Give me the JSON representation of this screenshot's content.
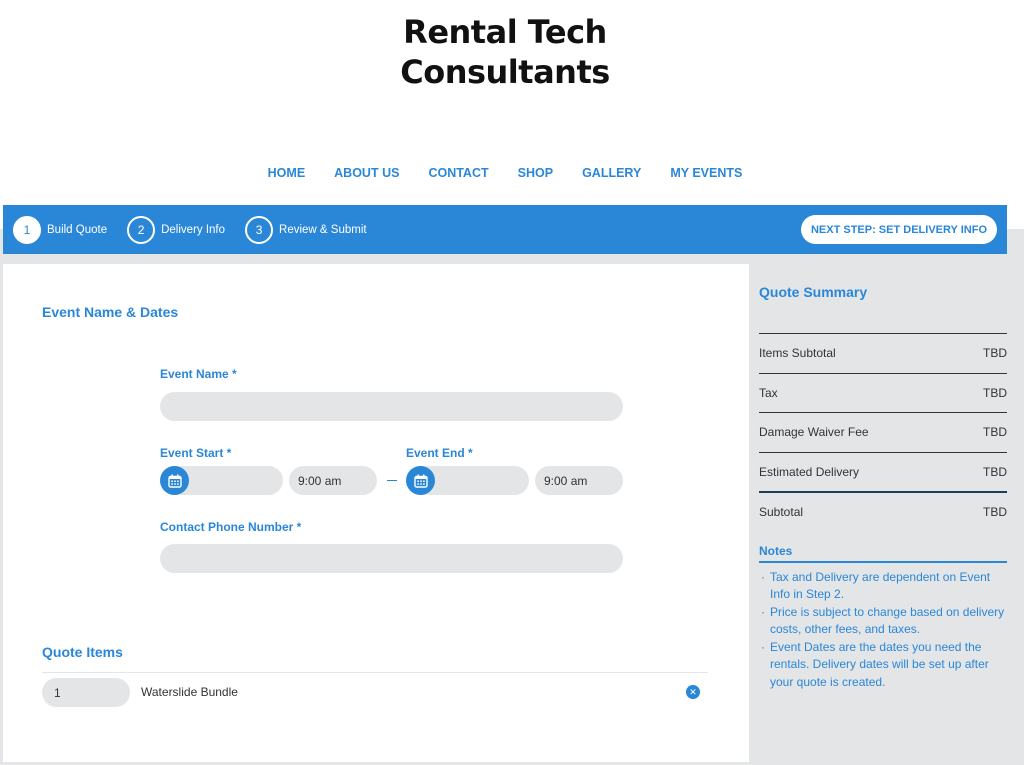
{
  "brand": {
    "line1": "Rental Tech",
    "line2": "Consultants"
  },
  "nav": [
    {
      "label": "HOME"
    },
    {
      "label": "ABOUT US"
    },
    {
      "label": "CONTACT"
    },
    {
      "label": "SHOP"
    },
    {
      "label": "GALLERY"
    },
    {
      "label": "MY EVENTS"
    }
  ],
  "steps": [
    {
      "num": "1",
      "label": "Build Quote",
      "active": true
    },
    {
      "num": "2",
      "label": "Delivery Info",
      "active": false
    },
    {
      "num": "3",
      "label": "Review & Submit",
      "active": false
    }
  ],
  "next_button": "NEXT STEP: SET DELIVERY INFO",
  "form": {
    "section_title": "Event Name & Dates",
    "event_name_label": "Event Name *",
    "event_name_value": "",
    "event_start_label": "Event Start *",
    "event_start_date": "",
    "event_start_time": "9:00 am",
    "event_end_label": "Event End *",
    "event_end_date": "",
    "event_end_time": "9:00 am",
    "phone_label": "Contact Phone Number *",
    "phone_value": ""
  },
  "quote_items": {
    "title": "Quote Items",
    "items": [
      {
        "qty": "1",
        "name": "Waterslide Bundle"
      }
    ]
  },
  "summary": {
    "title": "Quote Summary",
    "rows": [
      {
        "label": "Items Subtotal",
        "value": "TBD"
      },
      {
        "label": "Tax",
        "value": "TBD"
      },
      {
        "label": "Damage Waiver Fee",
        "value": "TBD"
      },
      {
        "label": "Estimated Delivery",
        "value": "TBD"
      }
    ],
    "subtotal": {
      "label": "Subtotal",
      "value": "TBD"
    }
  },
  "notes": {
    "title": "Notes",
    "items": [
      "Tax and Delivery are dependent on Event Info in Step 2.",
      "Price is subject to change based on delivery costs, other fees, and taxes.",
      "Event Dates are the dates you need the rentals. Delivery dates will be set up after your quote is created."
    ]
  },
  "colors": {
    "accent": "#2a87d8",
    "field_bg": "#e3e5e7",
    "panel_bg": "#e3e5e7"
  }
}
